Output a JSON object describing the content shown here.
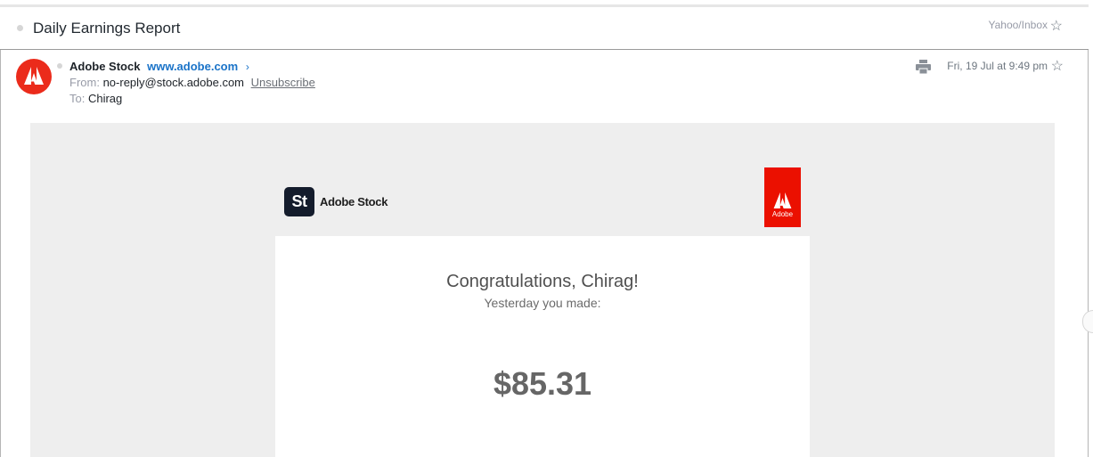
{
  "subject": "Daily Earnings Report",
  "folder": "Yahoo/Inbox",
  "message": {
    "sender_name": "Adobe Stock",
    "sender_link": "www.adobe.com",
    "from_label": "From:",
    "from_address": "no-reply@stock.adobe.com",
    "unsubscribe_label": "Unsubscribe",
    "to_label": "To:",
    "to_name": "Chirag",
    "date": "Fri, 19 Jul at 9:49 pm"
  },
  "email_body": {
    "brand_mark": "St",
    "brand_name": "Adobe Stock",
    "adobe_tag": "Adobe",
    "greeting": "Congratulations, Chirag!",
    "subline": "Yesterday you made:",
    "amount": "$85.31"
  },
  "icons": {
    "subject_star": "star-icon",
    "print": "print-icon",
    "message_star": "star-icon",
    "chevron": "chevron-right-icon",
    "avatar": "adobe-logo-icon"
  },
  "colors": {
    "adobe_red": "#eb1000",
    "link_blue": "#1a73c8",
    "stock_navy": "#141c2c",
    "email_background": "#eeeeee"
  }
}
